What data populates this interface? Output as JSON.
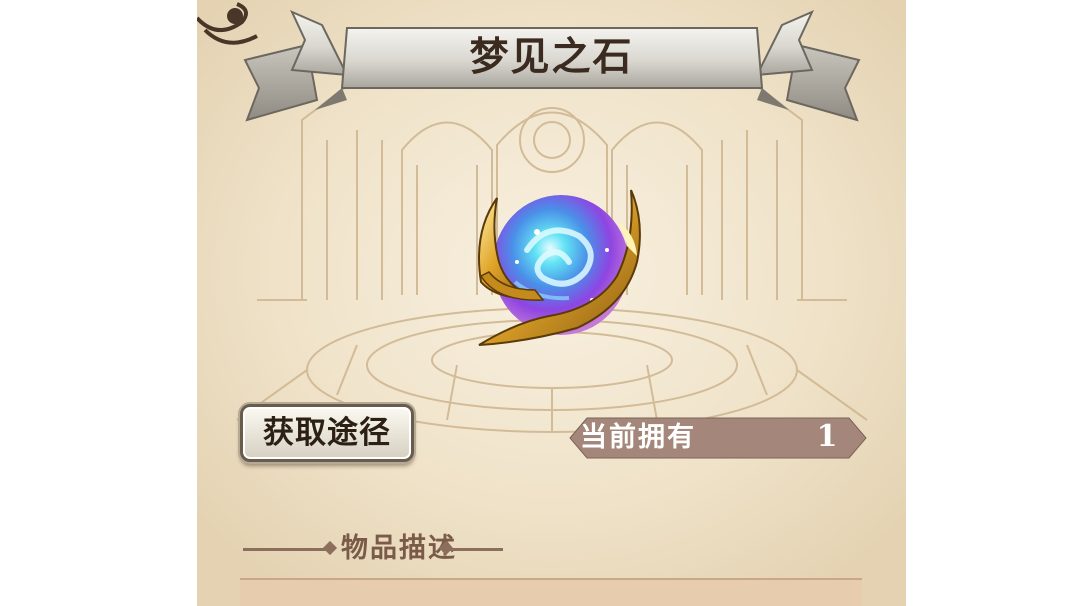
{
  "item": {
    "name": "梦见之石",
    "icon": "dream-orb-icon"
  },
  "actions": {
    "acquire_label": "获取途径"
  },
  "inventory": {
    "owned_label": "当前拥有",
    "owned_count": "1"
  },
  "description": {
    "header": "物品描述"
  },
  "colors": {
    "parchment": "#ede0c6",
    "owned_bar": "#a4877a",
    "title_text": "#3b2a1f",
    "orb_purple": "#9a48e6",
    "orb_cyan": "#3fd6ee",
    "gold": "#d9a328"
  }
}
